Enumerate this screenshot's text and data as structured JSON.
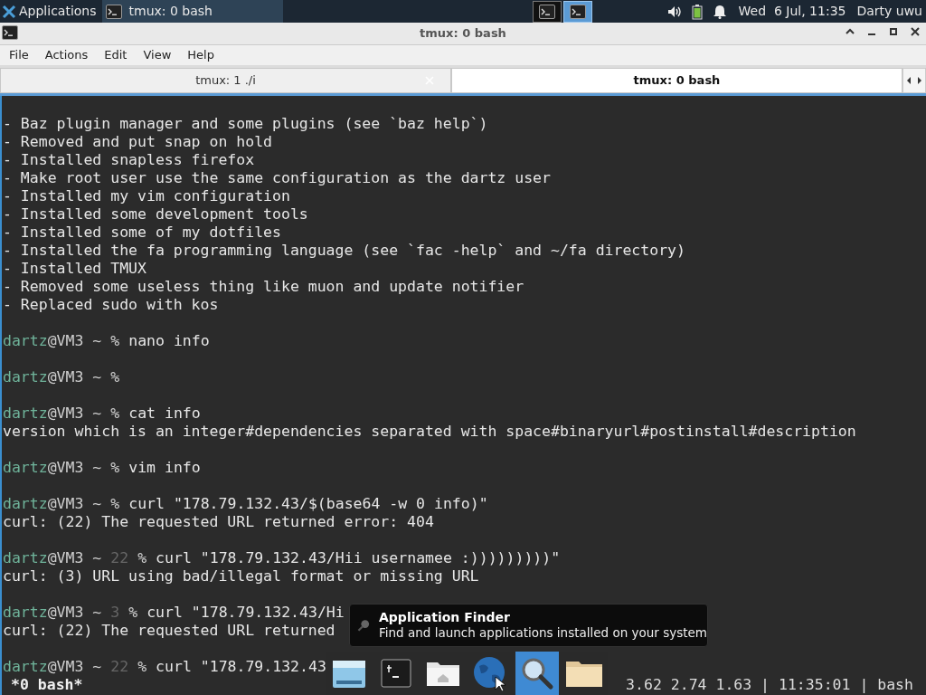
{
  "panel": {
    "menu": "Applications",
    "tasks": [
      {
        "label": "tmux: 0 bash",
        "selected": true
      }
    ],
    "workspaces": [
      {
        "selected": false
      },
      {
        "selected": true
      }
    ],
    "clock": "Wed  6 Jul, 11:35",
    "user": "Darty uwu"
  },
  "window": {
    "title": "tmux: 0 bash"
  },
  "menu": [
    "File",
    "Actions",
    "Edit",
    "View",
    "Help"
  ],
  "tabs": [
    {
      "label": "tmux: 1 ./i",
      "selected": false
    },
    {
      "label": "tmux: 0 bash",
      "selected": true
    }
  ],
  "terminal": {
    "lines": [
      {
        "kind": "text",
        "text": "- Baz plugin manager and some plugins (see `baz help`)"
      },
      {
        "kind": "text",
        "text": "- Removed and put snap on hold"
      },
      {
        "kind": "text",
        "text": "- Installed snapless firefox"
      },
      {
        "kind": "text",
        "text": "- Make root user use the same configuration as the dartz user"
      },
      {
        "kind": "text",
        "text": "- Installed my vim configuration"
      },
      {
        "kind": "text",
        "text": "- Installed some development tools"
      },
      {
        "kind": "text",
        "text": "- Installed some of my dotfiles"
      },
      {
        "kind": "text",
        "text": "- Installed the fa programming language (see `fac -help` and ~/fa directory)"
      },
      {
        "kind": "text",
        "text": "- Installed TMUX"
      },
      {
        "kind": "text",
        "text": "- Removed some useless thing like muon and update notifier"
      },
      {
        "kind": "text",
        "text": "- Replaced sudo with kos"
      },
      {
        "kind": "blank"
      },
      {
        "kind": "prompt",
        "user": "dartz",
        "host": "@VM3 ~",
        "sign": "%",
        "command": "nano info"
      },
      {
        "kind": "blank"
      },
      {
        "kind": "prompt",
        "user": "dartz",
        "host": "@VM3 ~",
        "sign": "%"
      },
      {
        "kind": "blank"
      },
      {
        "kind": "prompt",
        "user": "dartz",
        "host": "@VM3 ~",
        "sign": "%",
        "command": "cat info"
      },
      {
        "kind": "text",
        "text": "version which is an integer#dependencies separated with space#binaryurl#postinstall#description"
      },
      {
        "kind": "blank"
      },
      {
        "kind": "prompt",
        "user": "dartz",
        "host": "@VM3 ~",
        "sign": "%",
        "command": "vim info"
      },
      {
        "kind": "blank"
      },
      {
        "kind": "prompt",
        "user": "dartz",
        "host": "@VM3 ~",
        "sign": "%",
        "command": "curl \"178.79.132.43/$(base64 -w 0 info)\""
      },
      {
        "kind": "text",
        "text": "curl: (22) The requested URL returned error: 404"
      },
      {
        "kind": "blank"
      },
      {
        "kind": "prompt",
        "user": "dartz",
        "host": "@VM3 ~",
        "status": "22",
        "sign": "%",
        "command": "curl \"178.79.132.43/Hii usernamee :)))))))))\""
      },
      {
        "kind": "text",
        "text": "curl: (3) URL using bad/illegal format or missing URL"
      },
      {
        "kind": "blank"
      },
      {
        "kind": "prompt",
        "user": "dartz",
        "host": "@VM3 ~",
        "status": "3",
        "sign": "%",
        "command": "curl \"178.79.132.43/Hi"
      },
      {
        "kind": "text",
        "text": "curl: (22) The requested URL returned"
      },
      {
        "kind": "blank"
      },
      {
        "kind": "prompt",
        "user": "dartz",
        "host": "@VM3 ~",
        "status": "22",
        "sign": "%",
        "command": "curl \"178.79.132.43"
      }
    ]
  },
  "status_bar": {
    "window": "*0 bash*",
    "info": "3.62 2.74 1.63 | 11:35:01 | bash"
  },
  "tooltip": {
    "title": "Application Finder",
    "text": "Find and launch applications installed on your system"
  },
  "dock": [
    {
      "kind": "drive",
      "selected": false
    },
    {
      "kind": "terminal",
      "selected": false
    },
    {
      "kind": "home",
      "selected": false
    },
    {
      "kind": "globe",
      "selected": false
    },
    {
      "kind": "search",
      "selected": true
    },
    {
      "kind": "folder",
      "selected": false
    }
  ]
}
